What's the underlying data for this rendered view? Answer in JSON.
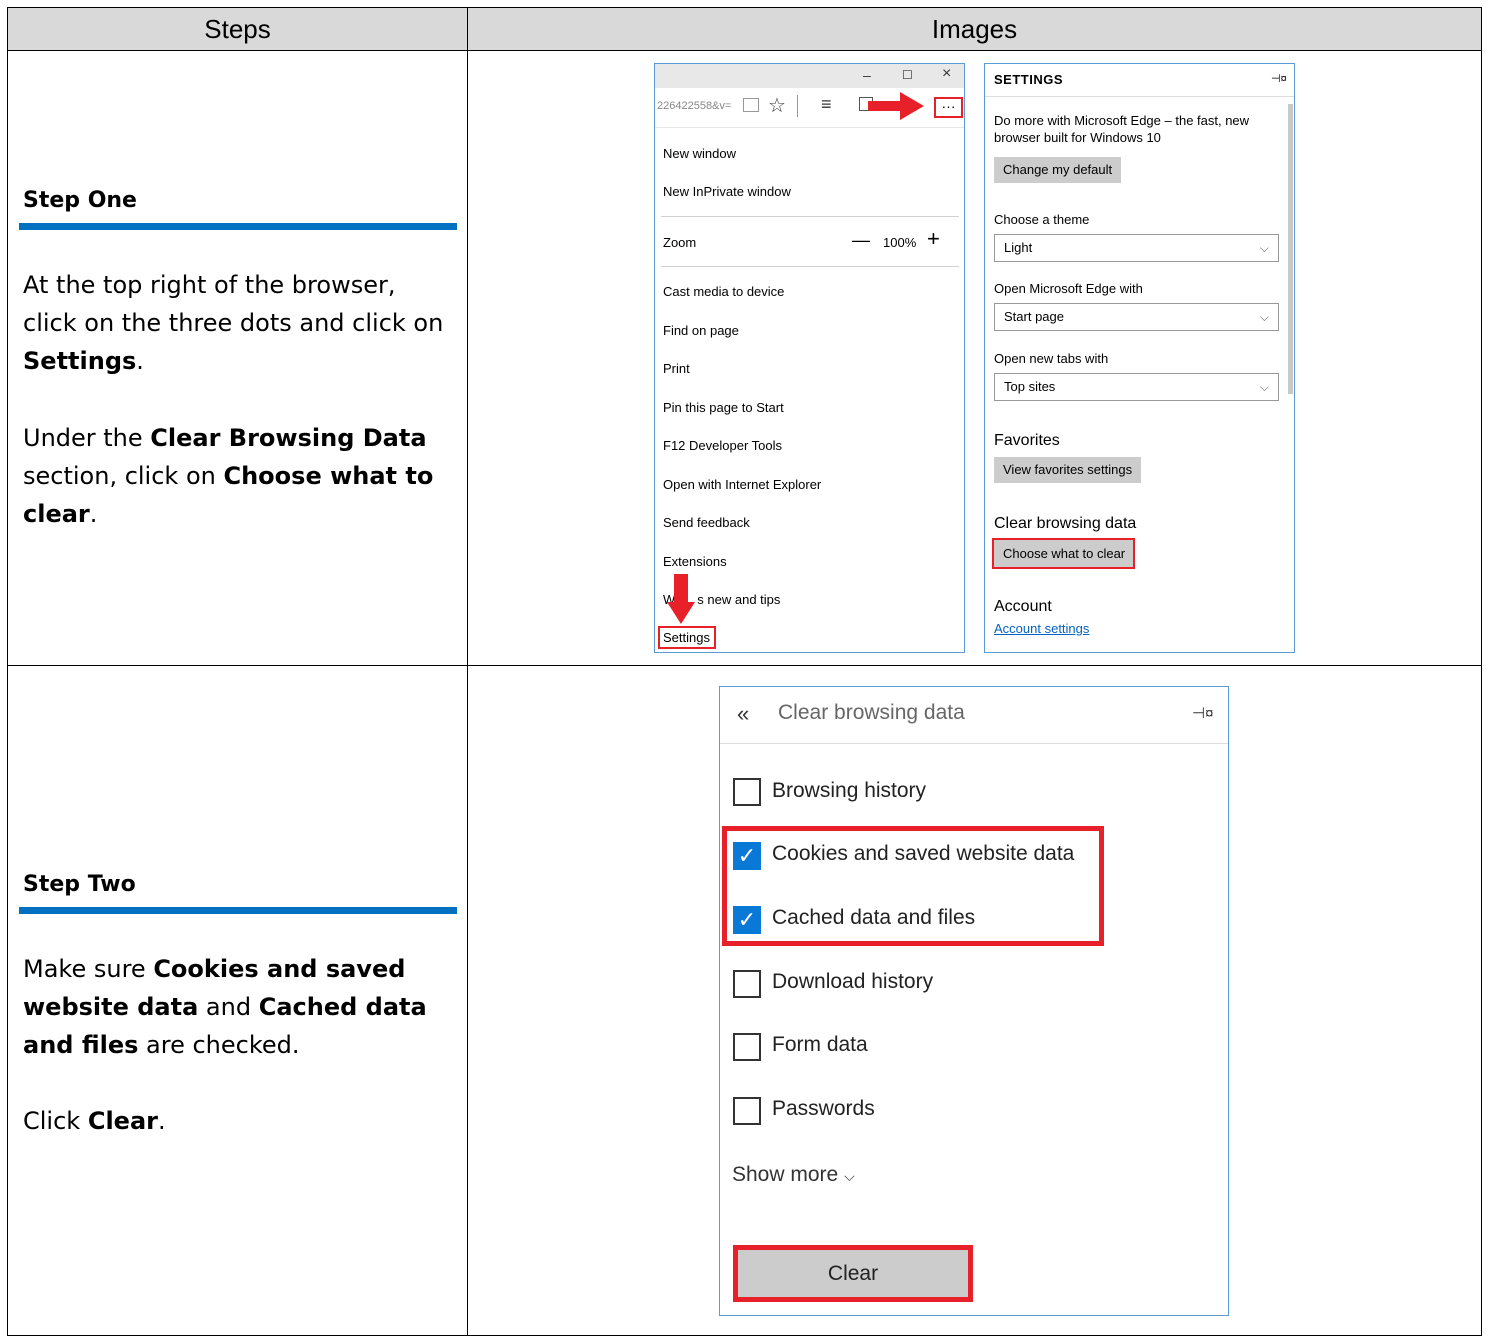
{
  "header": {
    "steps": "Steps",
    "images": "Images"
  },
  "step_one": {
    "title": "Step One",
    "p1_a": "At the top right of the browser, click on the three dots and click on ",
    "p1_b": "Settings",
    "p1_c": ".",
    "p2_a": "Under the ",
    "p2_b": "Clear Browsing Data",
    "p2_c": " section, click on ",
    "p2_d": "Choose what to clear",
    "p2_e": "."
  },
  "step_two": {
    "title": "Step Two",
    "p1_a": "Make sure ",
    "p1_b": "Cookies and saved website data",
    "p1_c": " and ",
    "p1_d": "Cached data and files",
    "p1_e": " are checked.",
    "p2_a": "Click ",
    "p2_b": "Clear",
    "p2_c": "."
  },
  "edge_menu": {
    "minimize": "–",
    "maximize": "☐",
    "close": "×",
    "address": "226422558&v=",
    "more": "···",
    "items": [
      "New window",
      "New InPrivate window",
      "Zoom",
      "Cast media to device",
      "Find on page",
      "Print",
      "Pin this page to Start",
      "F12 Developer Tools",
      "Open with Internet Explorer",
      "Send feedback",
      "Extensions",
      "What's new and tips",
      "Settings"
    ],
    "whats_new_visible": "s new and tips",
    "whats_new_prefix": "W",
    "zoom_minus": "—",
    "zoom_value": "100%",
    "zoom_plus": "+"
  },
  "settings": {
    "title": "SETTINGS",
    "pin": "⊣¤",
    "promo": "Do more with Microsoft Edge – the fast, new browser built for Windows 10",
    "change_default": "Change my default",
    "theme_label": "Choose a theme",
    "theme_value": "Light",
    "open_with_label": "Open Microsoft Edge with",
    "open_with_value": "Start page",
    "new_tabs_label": "Open new tabs with",
    "new_tabs_value": "Top sites",
    "favorites_head": "Favorites",
    "view_favorites": "View favorites settings",
    "clear_head": "Clear browsing data",
    "choose_clear": "Choose what to clear",
    "account_head": "Account",
    "account_link": "Account settings"
  },
  "clear_panel": {
    "back": "«",
    "title": "Clear browsing data",
    "pin": "⊣¤",
    "options": [
      {
        "label": "Browsing history",
        "checked": false
      },
      {
        "label": "Cookies and saved website data",
        "checked": true
      },
      {
        "label": "Cached data and files",
        "checked": true
      },
      {
        "label": "Download history",
        "checked": false
      },
      {
        "label": "Form data",
        "checked": false
      },
      {
        "label": "Passwords",
        "checked": false
      }
    ],
    "show_more": "Show more",
    "clear_button": "Clear"
  },
  "colors": {
    "step_bar": "#0070c0",
    "highlight": "#e8202a",
    "check": "#0a78d7",
    "header_bg": "#d9d9d9"
  }
}
